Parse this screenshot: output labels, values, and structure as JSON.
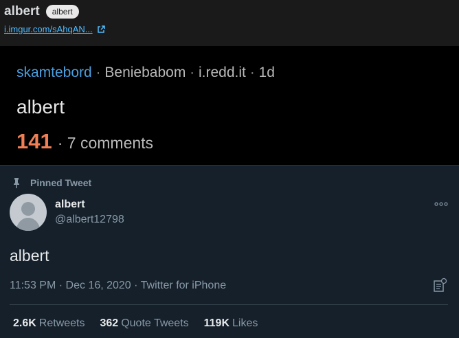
{
  "post": {
    "title": "albert",
    "flair": "albert",
    "link_text": "i.imgur.com/sAhqAN...",
    "link_icon": "external-link-icon"
  },
  "reddit_shot": {
    "subreddit": "skamtebord",
    "sep1": " · ",
    "user": "Beniebabom",
    "sep2": " · ",
    "domain": "i.redd.it",
    "sep3": " · ",
    "age": "1d",
    "title": "albert",
    "score": "141",
    "comments": "· 7 comments"
  },
  "tweet": {
    "pinned_label": "Pinned Tweet",
    "author_name": "albert",
    "author_handle": "@albert12798",
    "text": "albert",
    "timestamp": "11:53 PM · Dec 16, 2020 · Twitter for iPhone",
    "stats": [
      {
        "num": "2.6K",
        "label": "Retweets"
      },
      {
        "num": "362",
        "label": "Quote Tweets"
      },
      {
        "num": "119K",
        "label": "Likes"
      }
    ]
  },
  "colors": {
    "link": "#4fbcff",
    "subreddit": "#4a9fe0",
    "score": "#f07f56",
    "tweet_bg": "#15202b"
  }
}
